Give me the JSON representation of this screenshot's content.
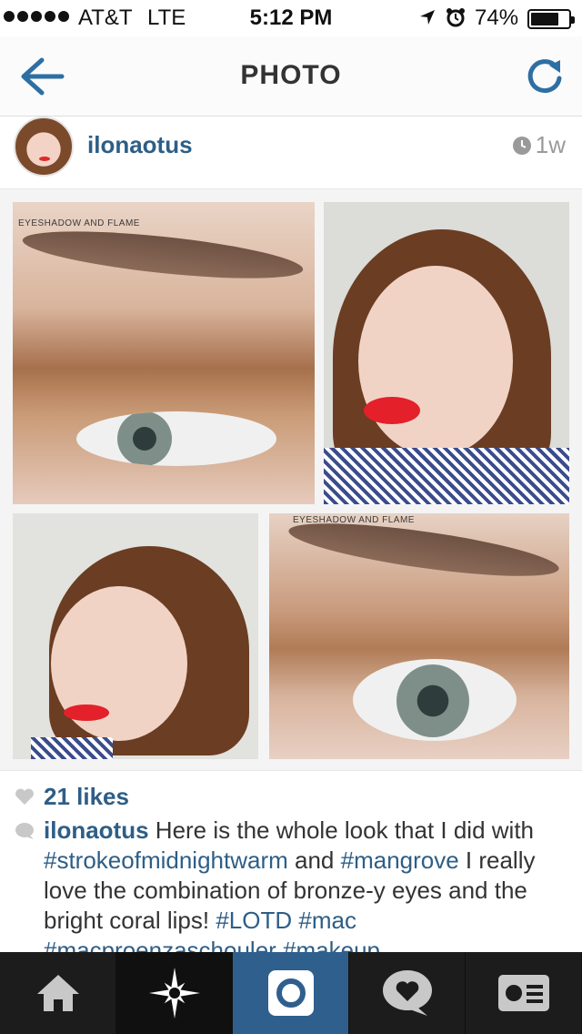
{
  "status_bar": {
    "carrier": "AT&T",
    "network": "LTE",
    "time": "5:12 PM",
    "battery_percent": "74%",
    "battery_level": 0.74,
    "signal_dots": 5,
    "icons": [
      "location-arrow-icon",
      "alarm-clock-icon",
      "battery-icon"
    ]
  },
  "nav": {
    "title": "PHOTO",
    "back_icon": "arrow-left-icon",
    "refresh_icon": "refresh-icon",
    "accent_color": "#2e6fa3"
  },
  "post": {
    "username": "ilonaotus",
    "age": "1w",
    "watermark_top": "EYESHADOW AND FLAME",
    "watermark_bottom": "EYESHADOW AND FLAME",
    "likes": "21 likes",
    "caption": {
      "user": "ilonaotus",
      "t1": " Here is the whole look that I did with ",
      "tag1": "#strokeofmidnightwarm",
      "t2": " and ",
      "tag2": "#mangrove",
      "t3": " I really love the combination of bronze-y eyes and the bright coral lips! ",
      "tag3": "#LOTD",
      "t4": " ",
      "tag4": "#mac",
      "t5": " ",
      "tag5": "#macproenzaschouler",
      "t6": " ",
      "tag6": "#makeup"
    }
  },
  "tabs": [
    {
      "name": "home",
      "icon": "home-icon"
    },
    {
      "name": "explore",
      "icon": "explore-star-icon"
    },
    {
      "name": "camera",
      "icon": "camera-icon",
      "active": true
    },
    {
      "name": "activity",
      "icon": "heart-bubble-icon"
    },
    {
      "name": "profile",
      "icon": "profile-card-icon"
    }
  ],
  "colors": {
    "link": "#2e5e86",
    "tab_bar": "#1c1c1c",
    "tab_active": "#2f5f8d"
  }
}
